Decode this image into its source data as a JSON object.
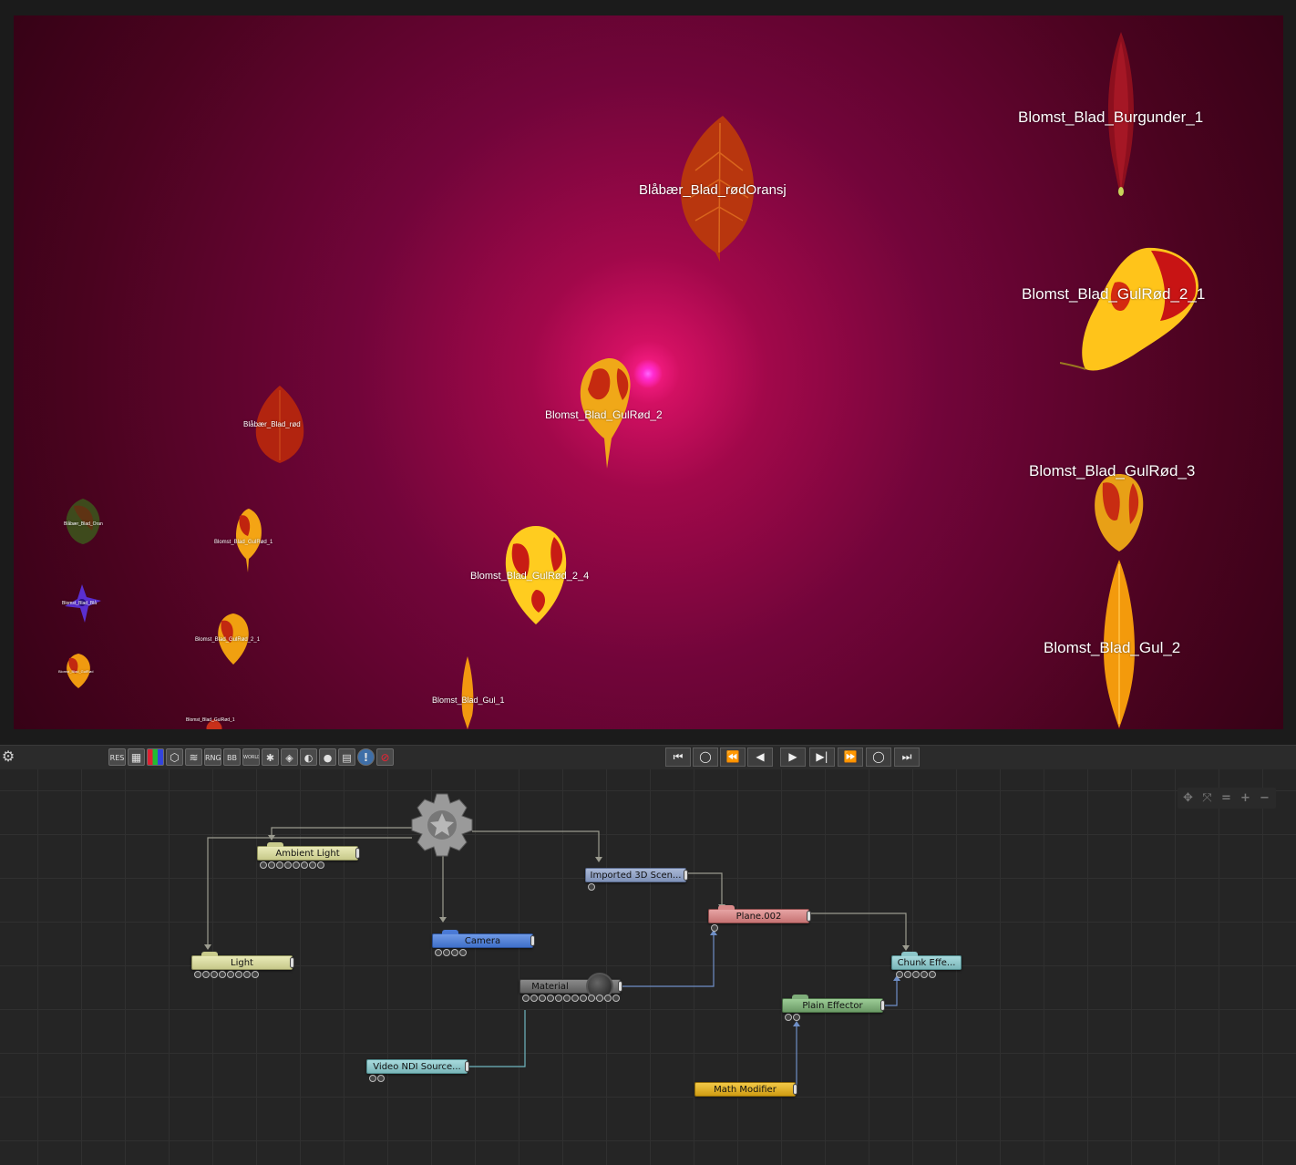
{
  "viewport": {
    "labels": [
      {
        "text": "Blomst_Blad_Burgunder_1",
        "size": "large"
      },
      {
        "text": "Blåbær_Blad_rødOransj",
        "size": "large"
      },
      {
        "text": "Blomst_Blad_GulRød_2_1",
        "size": "large"
      },
      {
        "text": "Blomst_Blad_GulRød_2",
        "size": "medium"
      },
      {
        "text": "Blomst_Blad_GulRød_3",
        "size": "large"
      },
      {
        "text": "Blomst_Blad_GulRød_2_4",
        "size": "medium"
      },
      {
        "text": "Blomst_Blad_Gul_2",
        "size": "large"
      },
      {
        "text": "Blomst_Blad_Gul_1",
        "size": "small"
      },
      {
        "text": "Blåbær_Blad_rød",
        "size": "small"
      },
      {
        "text": "Blomst_Blad_GulRød_1",
        "size": "tiny"
      },
      {
        "text": "Blomst_Blad_GulRød_2_1",
        "size": "tiny"
      },
      {
        "text": "Blomst_Blad_GulRød_1",
        "size": "tiny"
      },
      {
        "text": "Blåbær_Blad_Oran",
        "size": "tiny"
      },
      {
        "text": "Blomst_Blad_Blå",
        "size": "tiny"
      },
      {
        "text": "Blomst_Blad_GulRød",
        "size": "tiny"
      }
    ]
  },
  "toolbar": {
    "left_buttons": [
      {
        "text": "RES",
        "icon": "resolution-icon"
      },
      {
        "text": "▦",
        "icon": "grid-icon"
      },
      {
        "text": "▮▮",
        "icon": "color-bars-icon"
      },
      {
        "text": "⬡",
        "icon": "cube-icon"
      },
      {
        "text": "≋",
        "icon": "layers-icon"
      },
      {
        "text": "RNG",
        "icon": "range-icon"
      },
      {
        "text": "BB",
        "icon": "bounding-box-icon"
      },
      {
        "text": "WORLD",
        "icon": "world-icon"
      },
      {
        "text": "✱",
        "icon": "star-icon"
      },
      {
        "text": "◈",
        "icon": "object-icon"
      },
      {
        "text": "◐",
        "icon": "vr-icon"
      },
      {
        "text": "●",
        "icon": "sphere-icon"
      },
      {
        "text": "▤",
        "icon": "panel-icon"
      },
      {
        "text": "!",
        "icon": "warning-icon"
      },
      {
        "text": "⊘",
        "icon": "disable-icon"
      }
    ],
    "playback": [
      {
        "glyph": "⏮",
        "icon": "skip-to-start-icon"
      },
      {
        "glyph": "◯",
        "icon": "loop-back-icon"
      },
      {
        "glyph": "⏪",
        "icon": "rewind-icon"
      },
      {
        "glyph": "◀",
        "icon": "step-back-icon"
      },
      {
        "glyph": "▶",
        "icon": "play-icon"
      },
      {
        "glyph": "▶|",
        "icon": "step-forward-icon"
      },
      {
        "glyph": "⏩",
        "icon": "fast-forward-icon"
      },
      {
        "glyph": "◯",
        "icon": "loop-forward-icon"
      },
      {
        "glyph": "⏭",
        "icon": "skip-to-end-icon"
      }
    ]
  },
  "graph": {
    "zoom_controls": [
      {
        "glyph": "✥",
        "icon": "pan-icon"
      },
      {
        "glyph": "⤧",
        "icon": "fit-icon"
      },
      {
        "glyph": "=",
        "icon": "reset-zoom-icon"
      },
      {
        "glyph": "+",
        "icon": "zoom-in-icon"
      },
      {
        "glyph": "−",
        "icon": "zoom-out-icon"
      }
    ],
    "nodes": {
      "ambient_light": {
        "label": "Ambient  Light",
        "color": "#d6d89a"
      },
      "light": {
        "label": "Light",
        "color": "#d6d89a"
      },
      "camera": {
        "label": "Camera",
        "color": "#4a7fd6"
      },
      "imported_scene": {
        "label": "Imported  3D  Scen...",
        "color": "#8e9fc0"
      },
      "plane": {
        "label": "Plane.002",
        "color": "#d98a8a"
      },
      "chunk_effector": {
        "label": "Chunk  Effe...",
        "color": "#8cc6c9"
      },
      "material": {
        "label": "Material",
        "color": "#7a7a7a"
      },
      "plain_effector": {
        "label": "Plain  Effector",
        "color": "#7fae7a"
      },
      "video_ndi": {
        "label": "Video  NDI  Source...",
        "color": "#8cc6c9"
      },
      "math_modifier": {
        "label": "Math  Modifier",
        "color": "#e0b12a"
      }
    }
  }
}
